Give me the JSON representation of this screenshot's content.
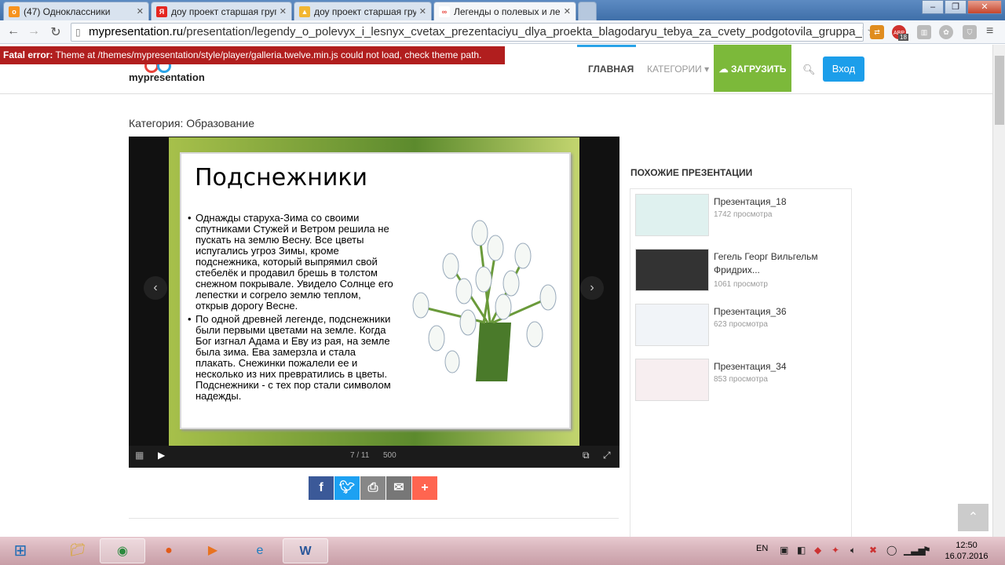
{
  "tabs": [
    {
      "title": "(47) Одноклассники",
      "icon": "ok-icon",
      "color": "#f7931e"
    },
    {
      "title": "доу проект старшая груп",
      "icon": "yandex-icon",
      "color": "#e52620"
    },
    {
      "title": "доу проект старшая груп",
      "icon": "yandex-images-icon",
      "color": "#f2b632"
    },
    {
      "title": "Легенды о полевых и лес",
      "icon": "mypresentation-icon",
      "color": "#e8433b"
    }
  ],
  "url": {
    "host": "mypresentation.ru",
    "path": "/presentation/legendy_o_polevyx_i_lesnyx_cvetax_prezentaciyu_dlya_proekta_blagodaryu_tebya_za_cvety_podgotovila_gruppa_i:"
  },
  "ext_badge": "18",
  "abp_label": "ABP",
  "error": {
    "prefix": "Fatal error:",
    "message": " Theme at /themes/mypresentation/style/player/galleria.twelve.min.js could not load, check theme path."
  },
  "site": {
    "logo": "mypresentation",
    "nav": {
      "home": "ГЛАВНАЯ",
      "categories": "КАТЕГОРИИ ▾",
      "upload": "ЗАГРУЗИТЬ",
      "login": "Вход"
    }
  },
  "category_line": "Категория: Образование",
  "slide": {
    "title": "Подснежники",
    "bullets": [
      "Однажды старуха-Зима со своими спутниками Стужей и Ветром решила не пускать на землю Весну. Все цветы испугались угроз Зимы, кроме подснежника, который выпрямил свой стебелёк и продавил брешь в толстом снежном покрывале. Увидело Солнце его лепестки и согрело землю теплом, открыв дорогу Весне.",
      "По одной древней легенде, подснежники были первыми цветами на земле. Когда Бог изгнал Адама и Еву из рая, на земле была зима. Ева замерзла и стала плакать. Снежинки пожалели ее и несколько из них превратились в цветы. Подснежники - с тех пор стали символом надежды."
    ]
  },
  "player": {
    "counter": "7 / 11",
    "size": "500"
  },
  "similar": {
    "heading": "ПОХОЖИЕ ПРЕЗЕНТАЦИИ",
    "items": [
      {
        "name": "Презентация_18",
        "views": "1742 просмотра"
      },
      {
        "name": "Гегель Георг Вильгельм Фридрих...",
        "views": "1061 просмотр"
      },
      {
        "name": "Презентация_36",
        "views": "623 просмотра"
      },
      {
        "name": "Презентация_34",
        "views": "853 просмотра"
      }
    ]
  },
  "taskbar": {
    "lang": "EN",
    "time": "12:50",
    "date": "16.07.2016"
  }
}
